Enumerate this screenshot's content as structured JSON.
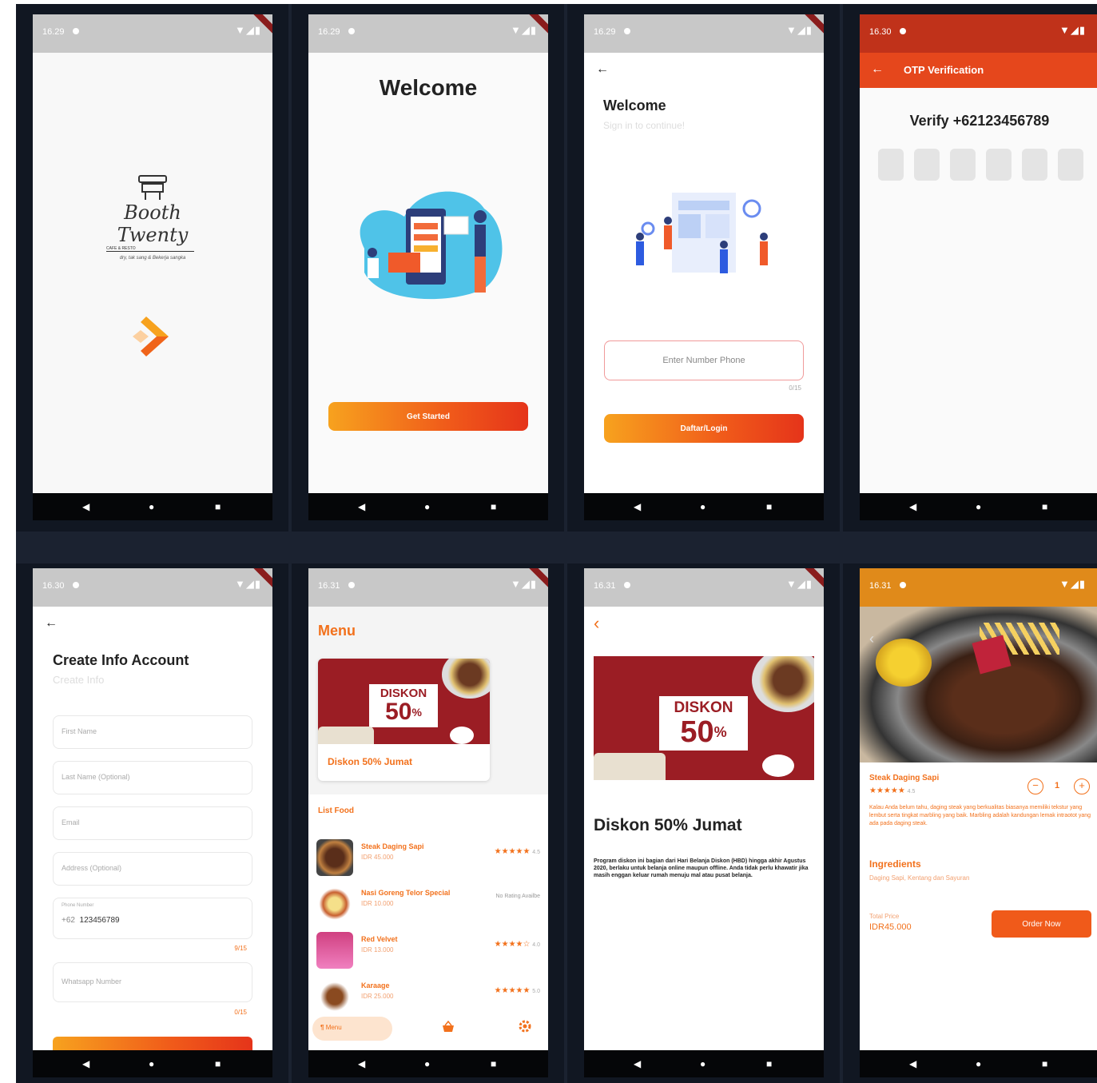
{
  "colors": {
    "accent": "#f2711c",
    "accent_dark": "#e5341a",
    "banner_red": "#9b1d24",
    "statusbar": "#c8c8c8",
    "board": "#111722"
  },
  "status": {
    "s1": "16.29",
    "s2": "16.29",
    "s3": "16.29",
    "s4": "16.30",
    "s5": "16.30",
    "s6": "16.31",
    "s7": "16.31",
    "s8": "16.31",
    "signal": "▼◢▮"
  },
  "nav": {
    "back": "◀",
    "home": "●",
    "recent": "■"
  },
  "splash": {
    "logo_text": "Booth Twenty",
    "logo_sub": "CAFE & RESTO",
    "tagline": "dry, tak sang & Bekerja sangka",
    "loader_icon": "chevron-loader-icon"
  },
  "welcome": {
    "title": "Welcome",
    "button": "Get Started"
  },
  "login": {
    "back": "←",
    "title": "Welcome",
    "subtitle": "Sign in to continue!",
    "phone_placeholder": "Enter Number Phone",
    "counter": "0/15",
    "button": "Daftar/Login"
  },
  "otp": {
    "back": "←",
    "header": "OTP Verification",
    "title": "Verify +62123456789"
  },
  "create": {
    "back": "←",
    "title": "Create Info Account",
    "subtitle": "Create Info",
    "first_name": "First Name",
    "last_name": "Last Name (Optional)",
    "email": "Email",
    "address": "Address (Optional)",
    "phone_label": "Phone Number",
    "phone_prefix": "+62",
    "phone_value": "123456789",
    "phone_counter": "9/15",
    "whatsapp": "Whatsapp Number",
    "whatsapp_counter": "0/15"
  },
  "menu": {
    "title": "Menu",
    "promo_caption": "Diskon 50% Jumat",
    "disk_word": "DISKON",
    "disk_pct": "50",
    "disk_pct_sign": "%",
    "list_title": "List Food",
    "foods": [
      {
        "name": "Steak Daging Sapi",
        "price": "IDR 45.000",
        "rating": "★★★★★",
        "score": "4.5"
      },
      {
        "name": "Nasi Goreng Telor Special",
        "price": "IDR 10.000",
        "rating": "No Rating Availbe",
        "score": ""
      },
      {
        "name": "Red Velvet",
        "price": "IDR 13.000",
        "rating": "★★★★☆",
        "score": "4.0"
      },
      {
        "name": "Karaage",
        "price": "IDR 25.000",
        "rating": "★★★★★",
        "score": "5.0"
      }
    ],
    "tab_menu": "Menu",
    "tab_menu_icon": "fork-knife-icon"
  },
  "promo": {
    "back": "‹",
    "disk_word": "DISKON",
    "disk_pct": "50",
    "disk_pct_sign": "%",
    "title": "Diskon 50% Jumat",
    "desc": "Program diskon ini bagian dari Hari Belanja Diskon (HBD) hingga akhir Agustus 2020, berlaku untuk belanja online maupun offline. Anda tidak perlu khawatir jika masih enggan keluar rumah menuju mal atau pusat belanja."
  },
  "detail": {
    "name": "Steak Daging Sapi",
    "stars": "★★★★★",
    "score": "4.5",
    "qty": "1",
    "minus": "−",
    "plus": "+",
    "desc": "Kalau Anda belum tahu, daging steak yang berkualitas biasanya memiliki tekstur yang lembut serta tingkat marbling yang baik. Marbling adalah kandungan lemak intraotot yang ada pada daging steak.",
    "ingredients_title": "Ingredients",
    "ingredients": "Daging Sapi, Kentang dan Sayuran",
    "total_label": "Total Price",
    "total": "IDR45.000",
    "order": "Order Now"
  }
}
